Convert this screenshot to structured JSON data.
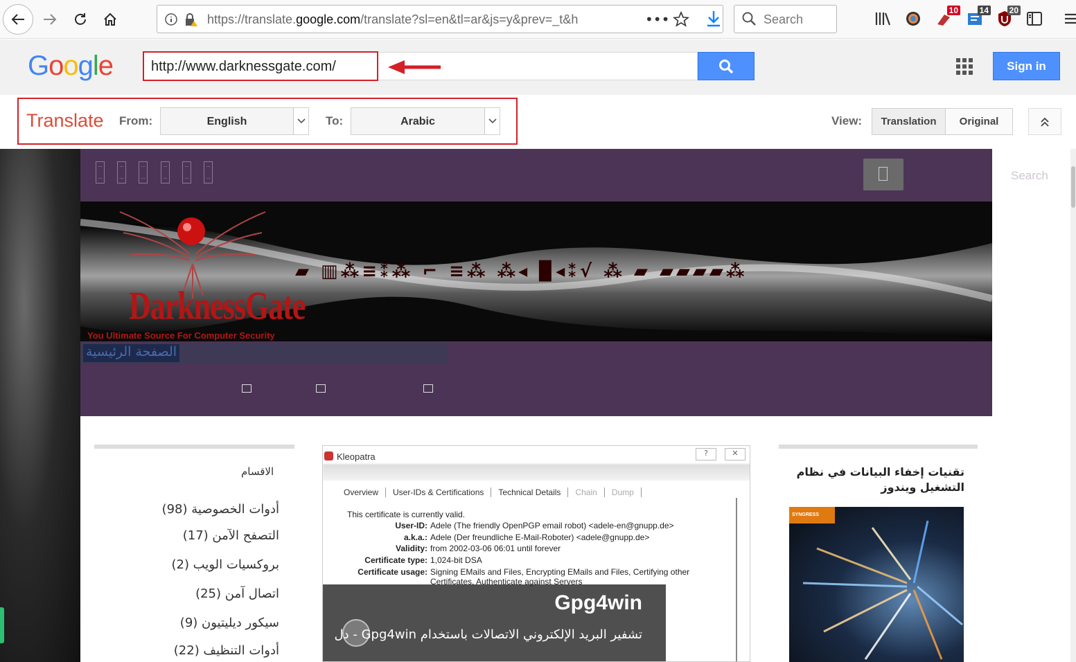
{
  "browser": {
    "url_prefix": "https://translate.",
    "url_domain": "google.com",
    "url_suffix": "/translate?sl=en&tl=ar&js=y&prev=_t&h",
    "search_placeholder": "Search",
    "badges": {
      "ext1": "10",
      "ext2": "14",
      "ext3": "20"
    }
  },
  "google": {
    "logo": [
      "G",
      "o",
      "o",
      "g",
      "l",
      "e"
    ],
    "logo_colors": [
      "#4285f4",
      "#ea4335",
      "#fbbc05",
      "#4285f4",
      "#34a853",
      "#ea4335"
    ],
    "input_value": "http://www.darknessgate.com/",
    "sign_in": "Sign in"
  },
  "translate": {
    "title": "Translate",
    "from_label": "From:",
    "from_value": "English",
    "to_label": "To:",
    "to_value": "Arabic",
    "view_label": "View:",
    "view_translation": "Translation",
    "view_original": "Original"
  },
  "site": {
    "search": "Search",
    "logo_text": "DarknessGate",
    "tagline": "You Ultimate Source For Computer Security",
    "banner_glyphs": "▰ ▥⁂≡⁑⁂  ⌐ ≡⁂  ⁂◂ ▉◂⁑√ ⁂ ▰ ▰▰▰▰⁂",
    "home_link": "الصفحة الرئيسية",
    "categories_title": "الاقسام",
    "categories": [
      "أدوات الخصوصية (98)",
      "التصفح الآمن (17)",
      "بروكسيات الويب (2)",
      "اتصال آمن (25)",
      "سيكور ديليتيون (9)",
      "أدوات التنظيف (22)"
    ],
    "kleopatra": {
      "title": "Kleopatra",
      "tabs": [
        "Overview",
        "User-IDs & Certifications",
        "Technical Details",
        "Chain",
        "Dump"
      ],
      "valid_msg": "This certificate is currently valid.",
      "rows": [
        {
          "k": "User-ID:",
          "v": "Adele (The friendly OpenPGP email robot) <adele-en@gnupp.de>"
        },
        {
          "k": "a.k.a.:",
          "v": "Adele (Der freundliche E-Mail-Roboter) <adele@gnupp.de>"
        },
        {
          "k": "Validity:",
          "v": "from 2002-03-06 06:01 until forever"
        },
        {
          "k": "Certificate type:",
          "v": "1,024-bit DSA"
        },
        {
          "k": "Certificate usage:",
          "v": "Signing EMails and Files, Encrypting EMails and Files, Certifying other"
        },
        {
          "k": "",
          "v": "Certificates, Authenticate against Servers"
        }
      ]
    },
    "gpg": {
      "name": "Gpg4win",
      "desc": "تشفير البريد الإلكتروني الاتصالات باستخدام Gpg4win - دل"
    },
    "side_title_1": "تقنيات إخفاء البيانات في نظام",
    "side_title_2": "التشغيل ويندوز",
    "book_publisher": "SYNGRESS"
  }
}
